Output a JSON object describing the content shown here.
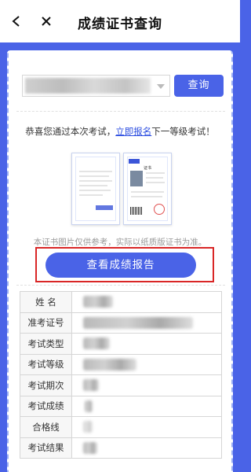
{
  "header": {
    "title": "成绩证书查询",
    "back_icon": "chevron-left-icon",
    "close_icon": "close-icon"
  },
  "search": {
    "query_button": "查询"
  },
  "message": {
    "prefix": "恭喜您通过本次考试，",
    "link": "立即报名",
    "suffix": "下一等级考试！"
  },
  "certificates": {
    "cert2_title": "证书"
  },
  "notice": "本证书图片仅供参考，实际以纸质版证书为准。",
  "report_button": "查看成绩报告",
  "table": {
    "rows": [
      {
        "label": "姓 名"
      },
      {
        "label": "准考证号"
      },
      {
        "label": "考试类型"
      },
      {
        "label": "考试等级"
      },
      {
        "label": "考试期次"
      },
      {
        "label": "考试成绩"
      },
      {
        "label": "合格线"
      },
      {
        "label": "考试结果"
      }
    ]
  },
  "colors": {
    "primary": "#4a63e7",
    "highlight_border": "#d92626",
    "link": "#2b4de0"
  }
}
